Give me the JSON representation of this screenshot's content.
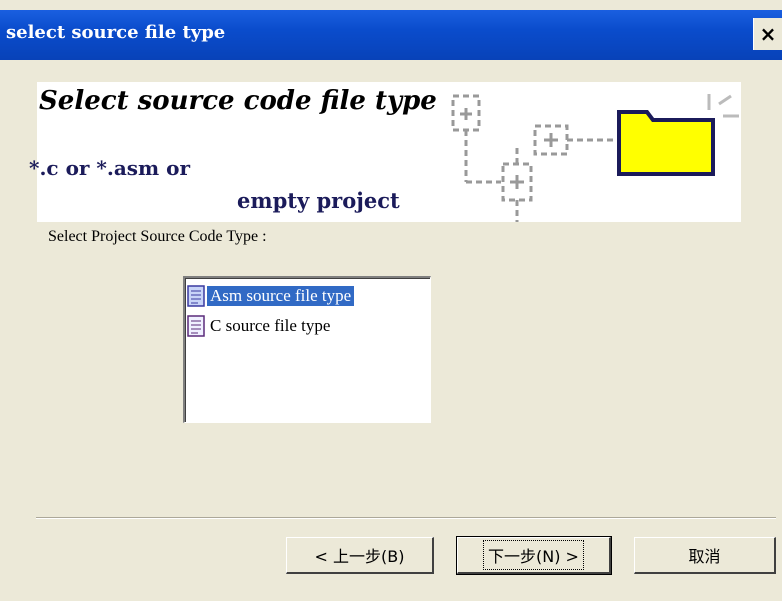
{
  "window": {
    "title": "select source file type",
    "close_glyph": "×"
  },
  "banner": {
    "title": "Select source code file type",
    "line1": "*.c  or *.asm or",
    "line2": "empty project",
    "folder_color": "#ffff00"
  },
  "section": {
    "label": "Select Project Source Code Type :"
  },
  "list": {
    "items": [
      {
        "label": "Asm source file type",
        "icon": "asm-file-icon",
        "selected": true
      },
      {
        "label": "C source file type",
        "icon": "c-file-icon",
        "selected": false
      }
    ]
  },
  "buttons": {
    "back": "< 上一步(B)",
    "next": "下一步(N) >",
    "cancel": "取消"
  },
  "colors": {
    "titlebar": "#0a4ccc",
    "selection": "#316ac5",
    "dialog_bg": "#ece9d8"
  }
}
